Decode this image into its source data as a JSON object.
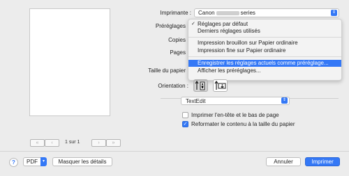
{
  "preview": {
    "page_indicator": "1 sur 1",
    "nav": {
      "first": "«",
      "prev": "‹",
      "next": "›",
      "last": "»"
    }
  },
  "printer": {
    "label": "Imprimante :",
    "value_prefix": "Canon",
    "value_suffix": "series"
  },
  "presets": {
    "label": "Préréglages",
    "menu": {
      "checkmark": "✓",
      "items": [
        "Réglages par défaut",
        "Derniers réglages utilisés",
        "Impression brouillon sur Papier ordinaire",
        "Impression fine sur Papier ordinaire",
        "Enregistrer les réglages actuels comme préréglage...",
        "Afficher les préréglages..."
      ],
      "selected_index": 0,
      "highlighted_index": 4
    }
  },
  "copies": {
    "label": "Copies"
  },
  "pages": {
    "label": "Pages"
  },
  "paper_size": {
    "label": "Taille du papier"
  },
  "orientation": {
    "label": "Orientation :",
    "selected": "portrait"
  },
  "app_section": {
    "value": "TextEdit"
  },
  "options": {
    "header_footer": {
      "label": "Imprimer l'en-tête et le bas de page",
      "checked": false
    },
    "reformat": {
      "label": "Reformater le contenu à la taille du papier",
      "checked": true
    }
  },
  "bottom": {
    "help": "?",
    "pdf": "PDF",
    "hide_details": "Masquer les détails",
    "cancel": "Annuler",
    "print": "Imprimer"
  },
  "colors": {
    "accent": "#3478f6",
    "window_bg": "#ececec"
  }
}
